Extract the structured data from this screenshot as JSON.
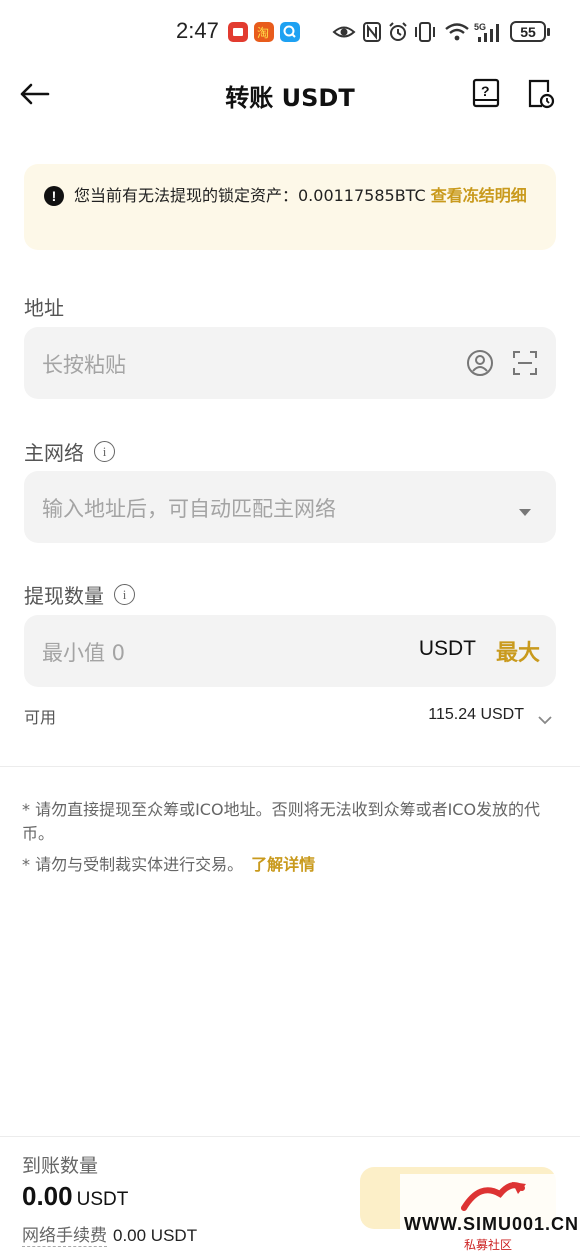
{
  "status_bar": {
    "time": "2:47",
    "battery": "55",
    "app_badges": [
      {
        "icon": "app-red-icon",
        "color": "#e23b30"
      },
      {
        "icon": "app-taobao-icon",
        "color": "#e85c1c"
      },
      {
        "icon": "app-search-icon",
        "color": "#1ea1f2"
      }
    ]
  },
  "header": {
    "title": "转账 USDT"
  },
  "notice": {
    "text": "您当前有无法提现的锁定资产：0.00117585BTC ",
    "link": "查看冻结明细"
  },
  "address": {
    "label": "地址",
    "placeholder": "长按粘贴"
  },
  "network": {
    "label": "主网络",
    "placeholder": "输入地址后，可自动匹配主网络"
  },
  "amount": {
    "label": "提现数量",
    "placeholder": "最小值 0",
    "unit": "USDT",
    "max_label": "最大",
    "available_label": "可用",
    "available_value": "115.24 USDT"
  },
  "tips": {
    "tip1": "* 请勿直接提现至众筹或ICO地址。否则将无法收到众筹或者ICO发放的代币。",
    "tip2": "* 请勿与受制裁实体进行交易。",
    "tip2_link": "了解详情"
  },
  "footer": {
    "arrival_label": "到账数量",
    "arrival_value": "0.00",
    "arrival_unit": "USDT",
    "fee_label": "网络手续费",
    "fee_value": "0.00 USDT"
  },
  "watermark": {
    "text": "WWW.SIMU001.CN",
    "sub": "私募社区"
  },
  "colors": {
    "accent": "#c99a1d",
    "notice_bg": "#fdf8e8",
    "input_bg": "#f3f3f3",
    "button_bg": "#fcefc8"
  }
}
